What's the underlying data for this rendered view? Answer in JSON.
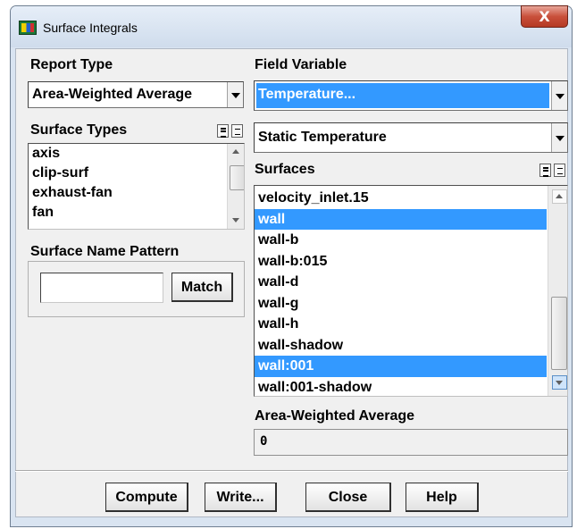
{
  "window": {
    "title": "Surface Integrals",
    "close_glyph": "X",
    "app_icon": "fluent-app-icon"
  },
  "report_type": {
    "label": "Report Type",
    "selected": "Area-Weighted Average"
  },
  "surface_types": {
    "label": "Surface Types",
    "items": [
      "axis",
      "clip-surf",
      "exhaust-fan",
      "fan"
    ]
  },
  "surface_name_pattern": {
    "label": "Surface Name Pattern",
    "value": "",
    "match_label": "Match"
  },
  "field_variable": {
    "label": "Field Variable",
    "category": "Temperature...",
    "variable": "Static Temperature"
  },
  "surfaces": {
    "label": "Surfaces",
    "items": [
      {
        "label": "velocity_inlet.15",
        "selected": false
      },
      {
        "label": "wall",
        "selected": true
      },
      {
        "label": "wall-b",
        "selected": false
      },
      {
        "label": "wall-b:015",
        "selected": false
      },
      {
        "label": "wall-d",
        "selected": false
      },
      {
        "label": "wall-g",
        "selected": false
      },
      {
        "label": "wall-h",
        "selected": false
      },
      {
        "label": "wall-shadow",
        "selected": false
      },
      {
        "label": "wall:001",
        "selected": true
      },
      {
        "label": "wall:001-shadow",
        "selected": false
      }
    ]
  },
  "result": {
    "label": "Area-Weighted Average",
    "value": "0"
  },
  "buttons": {
    "compute": "Compute",
    "write": "Write...",
    "close": "Close",
    "help": "Help"
  },
  "colors": {
    "selection": "#3399ff",
    "dialog_bg": "#f0f0f0",
    "frame": "#d9e4f1",
    "close_button": "#c9503b"
  }
}
